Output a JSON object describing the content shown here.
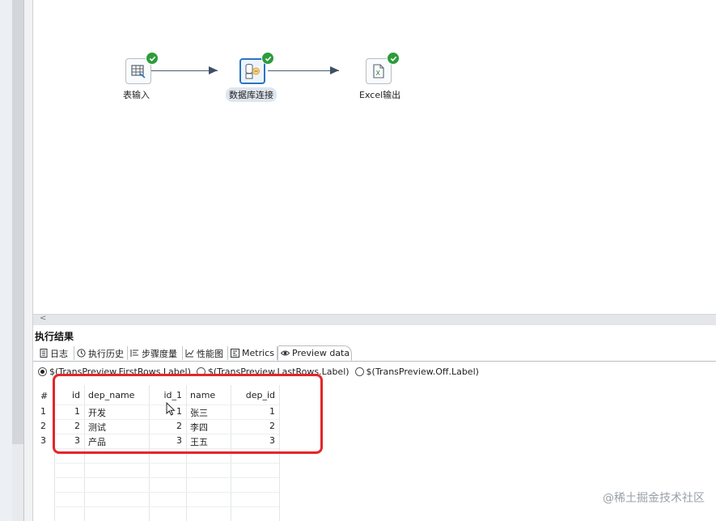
{
  "canvas": {
    "steps": [
      {
        "label": "表输入",
        "icon": "table-input-icon"
      },
      {
        "label": "数据库连接",
        "icon": "database-join-icon"
      },
      {
        "label": "Excel输出",
        "icon": "excel-output-icon"
      }
    ]
  },
  "results": {
    "title": "执行结果",
    "tabs": [
      {
        "label": "日志",
        "icon": "log-icon"
      },
      {
        "label": "执行历史",
        "icon": "history-icon"
      },
      {
        "label": "步骤度量",
        "icon": "step-metrics-icon"
      },
      {
        "label": "性能图",
        "icon": "performance-graph-icon"
      },
      {
        "label": "Metrics",
        "icon": "metrics-icon"
      },
      {
        "label": "Preview data",
        "icon": "eye-icon"
      }
    ],
    "active_tab": "Preview data",
    "radio_options": [
      "$(TransPreview.FirstRows.Label)",
      "$(TransPreview.LastRows.Label)",
      "$(TransPreview.Off.Label)"
    ],
    "selected_radio": "$(TransPreview.FirstRows.Label)",
    "columns": [
      "#",
      "id",
      "dep_name",
      "id_1",
      "name",
      "dep_id"
    ],
    "rows": [
      [
        "1",
        "1",
        "开发",
        "1",
        "张三",
        "1"
      ],
      [
        "2",
        "2",
        "测试",
        "2",
        "李四",
        "2"
      ],
      [
        "3",
        "3",
        "产品",
        "3",
        "王五",
        "3"
      ]
    ]
  },
  "scrollbar": {
    "left_arrow": "<"
  },
  "watermark": "@稀土掘金技术社区",
  "colors": {
    "highlight_box": "#e3262b",
    "success_check": "#2c9c3a",
    "selected_step_border": "#2a74c0"
  }
}
